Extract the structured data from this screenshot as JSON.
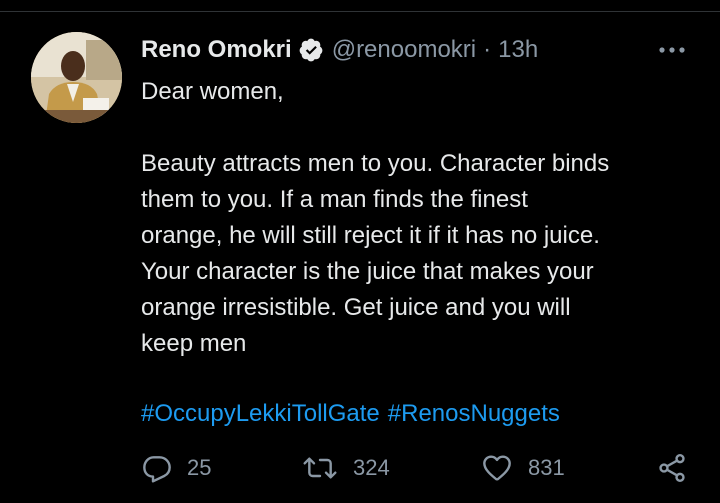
{
  "tweet": {
    "author_name": "Reno Omokri",
    "handle": "@renoomokri",
    "separator": "·",
    "time": "13h",
    "text_lines": [
      "Dear women,",
      "",
      "Beauty attracts men to you. Character binds",
      "them to you. If a man finds the finest",
      "orange, he will still reject it if it has no juice.",
      "Your character is the juice that makes your",
      "orange irresistible. Get juice and you will",
      "keep men"
    ],
    "hashtags": [
      "#OccupyLekkiTollGate",
      "#RenosNuggets"
    ]
  },
  "actions": {
    "reply_count": "25",
    "retweet_count": "324",
    "like_count": "831"
  },
  "icons": {
    "verified": "verified-badge-icon",
    "more": "more-horizontal-icon",
    "reply": "reply-icon",
    "retweet": "retweet-icon",
    "like": "heart-icon",
    "share": "share-icon"
  },
  "colors": {
    "background": "#000000",
    "text": "#e7e9ea",
    "muted": "#8b98a5",
    "link": "#1d9bf0"
  }
}
